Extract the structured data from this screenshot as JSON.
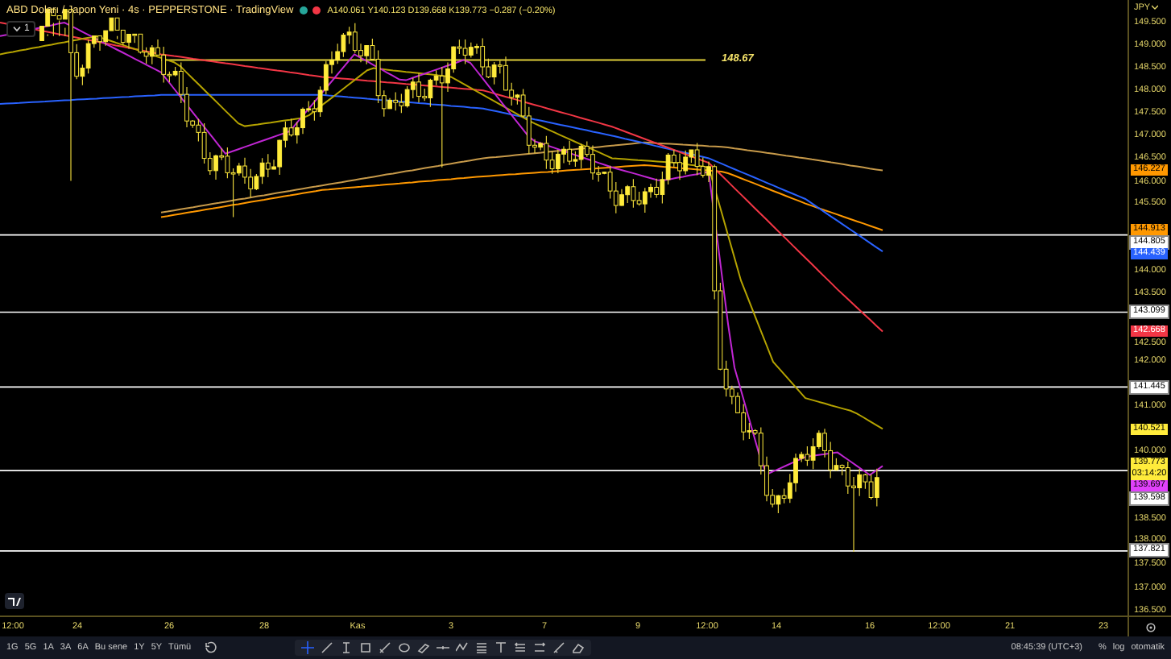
{
  "header": {
    "title": "ABD Doları / Japon Yeni · 4s · PEPPERSTONE · TradingView",
    "status_dots": [
      {
        "color": "#26a69a"
      },
      {
        "color": "#f23645"
      }
    ],
    "ohlc": "A140.061 Y140.123 D139.668 K139.773 −0.287 (−0.20%)",
    "collapse_count": "1"
  },
  "chart": {
    "currency": "JPY",
    "drawn_line_label": "148.67",
    "price_labels": [
      "149.500",
      "149.000",
      "148.500",
      "148.000",
      "147.500",
      "147.000",
      "146.500",
      "146.000",
      "145.500",
      "144.000",
      "143.500",
      "142.500",
      "142.000",
      "141.000",
      "140.000",
      "138.500",
      "138.000",
      "137.500",
      "137.000",
      "136.500"
    ],
    "price_tags": [
      {
        "text": "146.227",
        "color": "#ff9800",
        "kind": "indicator"
      },
      {
        "text": "144.913",
        "color": "#ff9800",
        "kind": "indicator"
      },
      {
        "text": "144.805",
        "color": "#ffffff",
        "kind": "horizontal-line"
      },
      {
        "text": "144.439",
        "color": "#2962ff",
        "kind": "indicator"
      },
      {
        "text": "143.099",
        "color": "#ffffff",
        "kind": "horizontal-line"
      },
      {
        "text": "142.668",
        "color": "#f23645",
        "kind": "indicator"
      },
      {
        "text": "141.445",
        "color": "#ffffff",
        "kind": "horizontal-line"
      },
      {
        "text": "140.521",
        "color": "#ffeb3b",
        "kind": "indicator"
      },
      {
        "text": "139.773",
        "color": "#ffeb3b",
        "kind": "last-price",
        "countdown": "03:14:20"
      },
      {
        "text": "139.697",
        "color": "#e040fb",
        "kind": "indicator"
      },
      {
        "text": "139.598",
        "color": "#ffffff",
        "kind": "horizontal-line"
      },
      {
        "text": "137.821",
        "color": "#ffffff",
        "kind": "horizontal-line"
      }
    ],
    "time_labels": [
      "12:00",
      "24",
      "26",
      "28",
      "Kas",
      "3",
      "7",
      "9",
      "12:00",
      "14",
      "16",
      "12:00",
      "21",
      "23"
    ]
  },
  "toolbar": {
    "ranges": [
      "1G",
      "5G",
      "1A",
      "3A",
      "6A",
      "Bu sene",
      "1Y",
      "5Y",
      "Tümü"
    ],
    "clock": "08:45:39 (UTC+3)",
    "scale_buttons": [
      "%",
      "log",
      "otomatik"
    ]
  }
}
